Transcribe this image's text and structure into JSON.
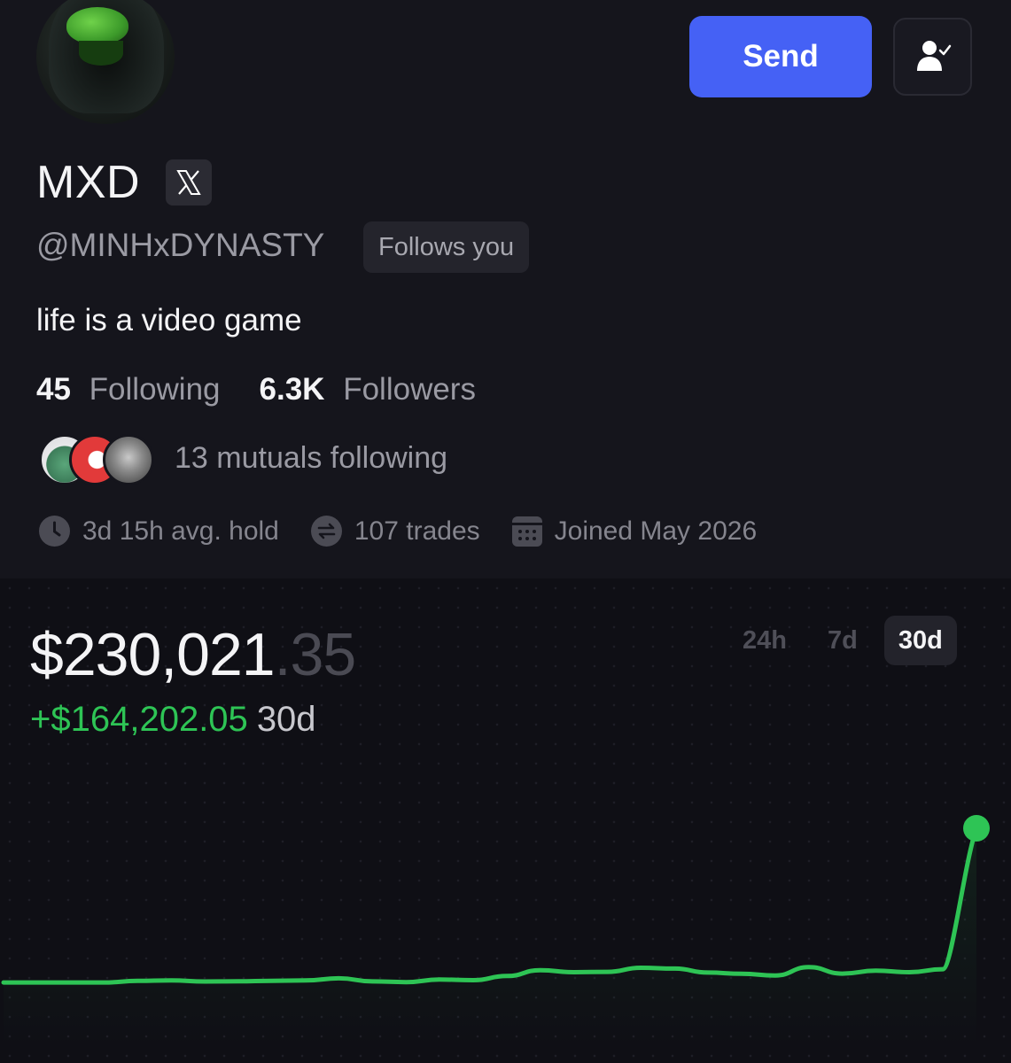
{
  "profile": {
    "display_name": "MXD",
    "handle": "@MINHxDYNASTY",
    "follows_you": "Follows you",
    "bio": "life is a video game",
    "following_count": "45",
    "following_label": "Following",
    "followers_count": "6.3K",
    "followers_label": "Followers",
    "mutuals_text": "13 mutuals following",
    "avg_hold": "3d 15h avg. hold",
    "trades": "107 trades",
    "joined": "Joined May 2026"
  },
  "actions": {
    "send_label": "Send",
    "follow_icon": "user-check-icon"
  },
  "portfolio": {
    "balance_main": "$230,021",
    "balance_decimal": ".35",
    "change_sign": "+",
    "change_value": "$164,202.05",
    "change_period": "30d",
    "ranges": [
      "24h",
      "7d",
      "30d"
    ],
    "active_range": "30d"
  },
  "colors": {
    "accent": "#4561f5",
    "gain": "#2ec455",
    "background": "#15151c"
  },
  "chart_data": {
    "type": "line",
    "title": "",
    "xlabel": "",
    "ylabel": "",
    "x": [
      0,
      1,
      2,
      3,
      4,
      5,
      6,
      7,
      8,
      9,
      10,
      11,
      12,
      13,
      14,
      15,
      16,
      17,
      18,
      19,
      20,
      21,
      22,
      23,
      24,
      25,
      26,
      27,
      28,
      29,
      30
    ],
    "series": [
      {
        "values": [
          65819,
          65819,
          65850,
          65819,
          67500,
          68000,
          66900,
          67100,
          67600,
          68000,
          70300,
          67000,
          66200,
          69000,
          68300,
          72700,
          79000,
          76800,
          77200,
          81500,
          80700,
          76400,
          75100,
          73300,
          82200,
          75300,
          78400,
          76800,
          80000,
          230021,
          230021
        ]
      }
    ]
  }
}
